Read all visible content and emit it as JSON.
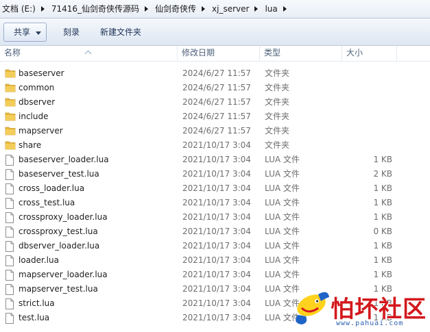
{
  "breadcrumb": [
    "文档 (E:)",
    "71416_仙剑奇侠传源码",
    "仙剑奇侠传",
    "xj_server",
    "lua"
  ],
  "toolbar": {
    "share_label": "共享",
    "burn_label": "刻录",
    "new_folder_label": "新建文件夹"
  },
  "columns": {
    "name": "名称",
    "date": "修改日期",
    "type": "类型",
    "size": "大小"
  },
  "rows": [
    {
      "name": "baseserver",
      "date": "2024/6/27 11:57",
      "type": "文件夹",
      "size": "",
      "icon": "folder-icon"
    },
    {
      "name": "common",
      "date": "2024/6/27 11:57",
      "type": "文件夹",
      "size": "",
      "icon": "folder-icon"
    },
    {
      "name": "dbserver",
      "date": "2024/6/27 11:57",
      "type": "文件夹",
      "size": "",
      "icon": "folder-icon"
    },
    {
      "name": "include",
      "date": "2024/6/27 11:57",
      "type": "文件夹",
      "size": "",
      "icon": "folder-icon"
    },
    {
      "name": "mapserver",
      "date": "2024/6/27 11:57",
      "type": "文件夹",
      "size": "",
      "icon": "folder-icon"
    },
    {
      "name": "share",
      "date": "2021/10/17 3:04",
      "type": "文件夹",
      "size": "",
      "icon": "folder-icon"
    },
    {
      "name": "baseserver_loader.lua",
      "date": "2021/10/17 3:04",
      "type": "LUA 文件",
      "size": "1 KB",
      "icon": "file-icon"
    },
    {
      "name": "baseserver_test.lua",
      "date": "2021/10/17 3:04",
      "type": "LUA 文件",
      "size": "2 KB",
      "icon": "file-icon"
    },
    {
      "name": "cross_loader.lua",
      "date": "2021/10/17 3:04",
      "type": "LUA 文件",
      "size": "1 KB",
      "icon": "file-icon"
    },
    {
      "name": "cross_test.lua",
      "date": "2021/10/17 3:04",
      "type": "LUA 文件",
      "size": "1 KB",
      "icon": "file-icon"
    },
    {
      "name": "crossproxy_loader.lua",
      "date": "2021/10/17 3:04",
      "type": "LUA 文件",
      "size": "1 KB",
      "icon": "file-icon"
    },
    {
      "name": "crossproxy_test.lua",
      "date": "2021/10/17 3:04",
      "type": "LUA 文件",
      "size": "0 KB",
      "icon": "file-icon"
    },
    {
      "name": "dbserver_loader.lua",
      "date": "2021/10/17 3:04",
      "type": "LUA 文件",
      "size": "1 KB",
      "icon": "file-icon"
    },
    {
      "name": "loader.lua",
      "date": "2021/10/17 3:04",
      "type": "LUA 文件",
      "size": "1 KB",
      "icon": "file-icon"
    },
    {
      "name": "mapserver_loader.lua",
      "date": "2021/10/17 3:04",
      "type": "LUA 文件",
      "size": "1 KB",
      "icon": "file-icon"
    },
    {
      "name": "mapserver_test.lua",
      "date": "2021/10/17 3:04",
      "type": "LUA 文件",
      "size": "1 KB",
      "icon": "file-icon"
    },
    {
      "name": "strict.lua",
      "date": "2021/10/17 3:04",
      "type": "LUA 文件",
      "size": "1 KB",
      "icon": "file-icon"
    },
    {
      "name": "test.lua",
      "date": "2021/10/17 3:04",
      "type": "LUA 文件",
      "size": "1 KB",
      "icon": "file-icon"
    }
  ],
  "watermark": {
    "title": "怕坏社区",
    "url": "www.pahuai.com"
  },
  "colors": {
    "folder": "#e8b93c",
    "header_text": "#4c607a",
    "watermark_red": "#d3181c"
  }
}
